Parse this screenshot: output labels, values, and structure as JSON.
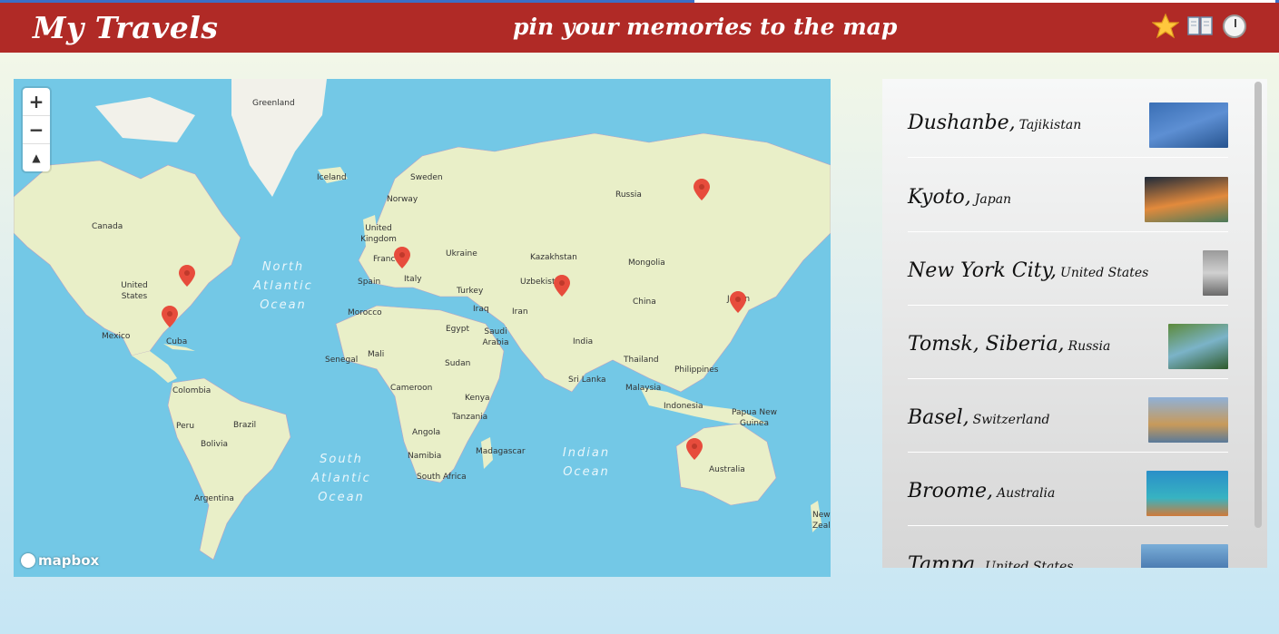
{
  "header": {
    "brand": "My Travels",
    "tagline": "pin your memories to the map",
    "icons": [
      "star-icon",
      "book-icon",
      "clock-icon"
    ]
  },
  "map": {
    "controls": {
      "zoom_in": "+",
      "zoom_out": "−",
      "compass": "▲"
    },
    "attribution": "mapbox",
    "countries": [
      "Greenland",
      "Iceland",
      "Sweden",
      "Norway",
      "Russia",
      "Canada",
      "United Kingdom",
      "France",
      "Ukraine",
      "Kazakhstan",
      "Mongolia",
      "Spain",
      "Italy",
      "Turkey",
      "Uzbekistan",
      "United States",
      "China",
      "Japan",
      "Morocco",
      "Iraq",
      "Iran",
      "Egypt",
      "Mexico",
      "Cuba",
      "Saudi Arabia",
      "India",
      "Mali",
      "Senegal",
      "Sudan",
      "Thailand",
      "Philippines",
      "Sri Lanka",
      "Colombia",
      "Cameroon",
      "Kenya",
      "Malaysia",
      "Indonesia",
      "Papua New Guinea",
      "Peru",
      "Brazil",
      "Tanzania",
      "Bolivia",
      "Angola",
      "Namibia",
      "Madagascar",
      "South Africa",
      "Australia",
      "Argentina",
      "New Zealand"
    ],
    "oceans": [
      "North Atlantic Ocean",
      "South Atlantic Ocean",
      "Indian Ocean"
    ],
    "pin_color": "#e74c3c"
  },
  "places": [
    {
      "city": "Dushanbe,",
      "country": "Tajikistan",
      "thumb_colors": [
        "#3a6fb5",
        "#5d8fd3",
        "#27548f"
      ]
    },
    {
      "city": "Kyoto,",
      "country": "Japan",
      "thumb_colors": [
        "#1e2a3a",
        "#e28a3c",
        "#4a7a5a"
      ]
    },
    {
      "city": "New York City,",
      "country": "United States",
      "thumb_colors": [
        "#9a9a9a",
        "#d0d0d0",
        "#6a6a6a"
      ]
    },
    {
      "city": "Tomsk, Siberia,",
      "country": "Russia",
      "thumb_colors": [
        "#5c8a3a",
        "#7bb3c8",
        "#2e5a2a"
      ]
    },
    {
      "city": "Basel,",
      "country": "Switzerland",
      "thumb_colors": [
        "#8fb1d8",
        "#c89a5a",
        "#5a7a9a"
      ]
    },
    {
      "city": "Broome,",
      "country": "Australia",
      "thumb_colors": [
        "#2a8fc8",
        "#37b3c2",
        "#d07a3a"
      ]
    },
    {
      "city": "Tampa,",
      "country": "United States",
      "thumb_colors": [
        "#7aaed8",
        "#4a7ab0",
        "#2a4a70"
      ]
    }
  ]
}
